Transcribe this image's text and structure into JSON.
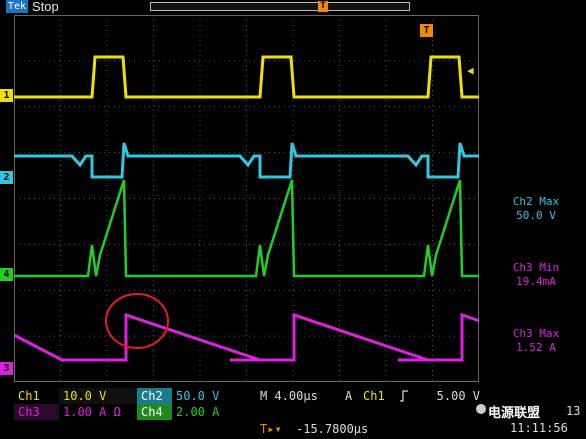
{
  "topbar": {
    "acquisition_badge": "Tek",
    "state": "Stop",
    "trigger_position_marker": "T"
  },
  "graticule": {
    "horizontal_divisions": 10,
    "vertical_divisions": 8,
    "trigger_marker": "T",
    "trigger_level_arrow": "◀"
  },
  "channels": [
    {
      "id": "1",
      "color": "#f0e000",
      "marker": "1"
    },
    {
      "id": "2",
      "color": "#30c8e0",
      "marker": "2"
    },
    {
      "id": "3",
      "color": "#e020e0",
      "marker": "3"
    },
    {
      "id": "4",
      "color": "#20d020",
      "marker": "4"
    }
  ],
  "measurements": [
    {
      "label": "Ch2 Max",
      "value": "50.0 V",
      "color": "#30c8e0"
    },
    {
      "label": "Ch3 Min",
      "value": "19.4mA",
      "color": "#e020e0"
    },
    {
      "label": "Ch3 Max",
      "value": "1.52 A",
      "color": "#e020e0"
    }
  ],
  "status_row1": {
    "ch1_label": "Ch1",
    "ch1_scale": "10.0 V",
    "ch2_label": "Ch2",
    "ch2_scale": "50.0 V",
    "timebase": "M 4.00µs",
    "acq_mode": "A",
    "trig_source": "Ch1",
    "trig_slope_icon": "rising-edge",
    "trig_level": "5.00 V"
  },
  "status_row2": {
    "ch3_label": "Ch3",
    "ch3_scale": "1.00 A Ω",
    "ch4_label": "Ch4",
    "ch4_scale": "2.00 A"
  },
  "status_row3": {
    "trigger_offset_marker": "T▸▾",
    "trigger_offset": "-15.7800µs"
  },
  "corner": {
    "date_fragment": "13",
    "time": "11:11:56",
    "watermark": "电源联盟"
  },
  "annotation": {
    "shape": "circle",
    "color": "#e02020"
  }
}
